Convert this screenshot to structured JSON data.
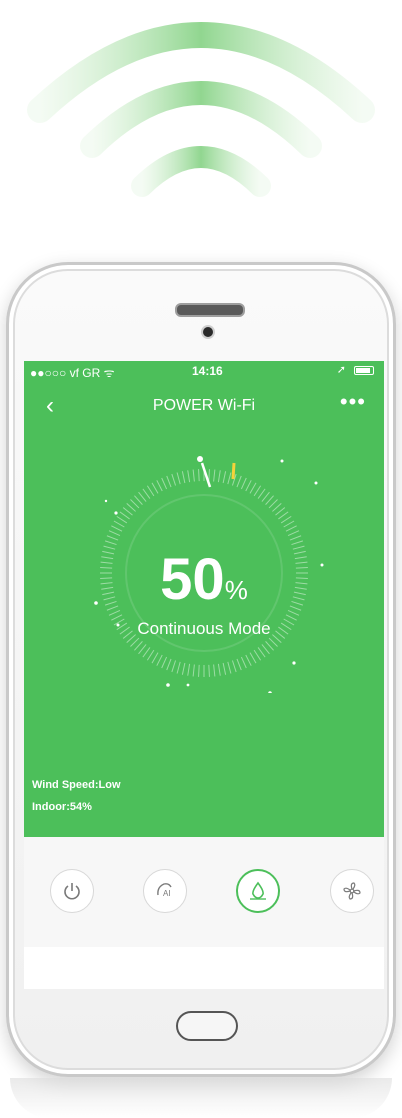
{
  "status_bar": {
    "carrier": "●●○○○ vf GR ᯤ",
    "time": "14:16"
  },
  "header": {
    "back_icon": "‹",
    "title": "POWER Wi-Fi",
    "more_icon": "•••"
  },
  "gauge": {
    "value": "50",
    "unit": "%",
    "mode_label": "Continuous Mode",
    "level": 0.5
  },
  "info": {
    "wind_speed": "Wind Speed:Low",
    "indoor": "Indoor:54%"
  },
  "controls": {
    "buttons": [
      {
        "icon": "power-icon"
      },
      {
        "icon": "ai-mode-icon"
      },
      {
        "icon": "drop-icon",
        "active": true
      },
      {
        "icon": "fan-icon"
      }
    ]
  },
  "colors": {
    "accent": "#4cbf5a",
    "indicator": "#f5d33a"
  }
}
